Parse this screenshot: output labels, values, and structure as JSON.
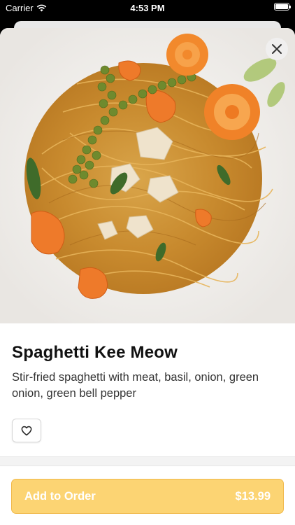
{
  "status_bar": {
    "carrier": "Carrier",
    "time": "4:53 PM"
  },
  "item": {
    "name": "Spaghetti Kee Meow",
    "description": "Stir-fried spaghetti with meat, basil, onion, green onion, green bell pepper"
  },
  "order_button": {
    "label": "Add to Order",
    "price": "$13.99"
  },
  "icons": {
    "close": "close-icon",
    "favorite": "heart-icon",
    "wifi": "wifi-icon",
    "battery": "battery-icon"
  },
  "colors": {
    "accent": "#fcd473",
    "accent_border": "#f0b848"
  }
}
